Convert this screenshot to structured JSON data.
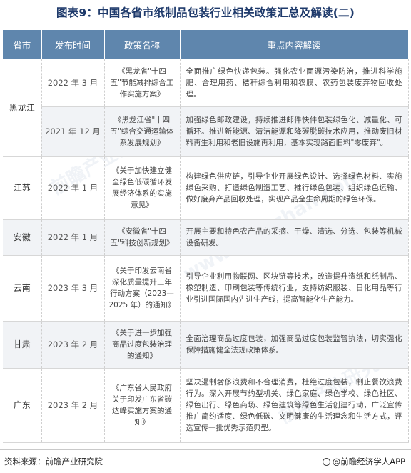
{
  "title": "图表9：中国各省市纸制品包装行业相关政策汇总及解读(二)",
  "columns": [
    "省市",
    "发布时间",
    "政策名称",
    "重点内容解读"
  ],
  "rows": [
    {
      "province": "黑龙江",
      "date": "2022 年 3 月",
      "policy": "《黑龙省\"十四五\"节能减排综合工作实施方案》",
      "points": "全面推广绿色快递包装。强化农业面源污染防治，推进科学施肥、合理用药、秸秆综合利用和农膜、农药包装废弃物回收处理。"
    },
    {
      "province": "",
      "date": "2021 年 12 月",
      "policy": "《黑龙江省\"十四五\"综合交通运输体系发展规划》",
      "points": "加强绿色邮政建设，持续推进邮件快件包装绿色化、减量化、可循环。推进新能源、清洁能源和降碳脱碳技术应用，推动废旧材料再生利用和老旧设施再利用，基本实现路面旧料\"零废弃\"。"
    },
    {
      "province": "江苏",
      "date": "2022 年 1 月",
      "policy": "《关于加快建立健全绿色低碳循环发展经济体系的实施意见》",
      "points": "构建绿色供应链，引导企业开展绿色设计、选择绿色材料、实施绿色采购、打造绿色制造工艺、推行绿色包装、组织绿色运输、做好废弃产品回收处理，实现产品全生命周期的绿色环保。"
    },
    {
      "province": "安徽",
      "date": "2022 年 1 月",
      "policy": "《安徽省\"十四五\"科技创新规划》",
      "points": "开展主要和特色农产品的采摘、干燥、清选、分选、包装等机械设备研发。"
    },
    {
      "province": "云南",
      "date": "2023 年 3 月",
      "policy": "《关于印发云南省深化质量提升三年行动方案（2023—2025 年）的通知》",
      "points": "引导企业利用物联网、区块链等技术，改造提升造纸和纸制品、橡塑制造、印刷包装等传统行业，支持纺织服装、日化用品等行业引进国际国内先进生产线，提高智能化生产能力。"
    },
    {
      "province": "甘肃",
      "date": "2023 年 2 月",
      "policy": "《关于进一步加强商品过度包装治理的通知》",
      "points": "全面治理商品过度包装，加强商品过度包装监管执法，切实强化保障措施健全法规政策体系。"
    },
    {
      "province": "广东",
      "date": "2023 年 2 月",
      "policy": "《广东省人民政府关于印发广东省碳达峰实施方案的通知》",
      "points": "坚决遏制奢侈浪费和不合理消费，杜绝过度包装，制止餐饮浪费行为。深入开展节约型机关、绿色家庭、绿色学校、绿色社区、绿色出行、绿色商场、绿色建筑等绿色生活创建行动，广泛宣传推广简约适度、绿色低碳、文明健康的生活理念和生活方式，评选宣传一批优秀示范典型。"
    }
  ],
  "footer": {
    "source": "资料来源：前瞻产业研究院",
    "brand": "@前瞻经济学人APP"
  },
  "watermark": [
    "前瞻产业研究院",
    "www.qianzhan.com",
    "前瞻产业研究院"
  ]
}
